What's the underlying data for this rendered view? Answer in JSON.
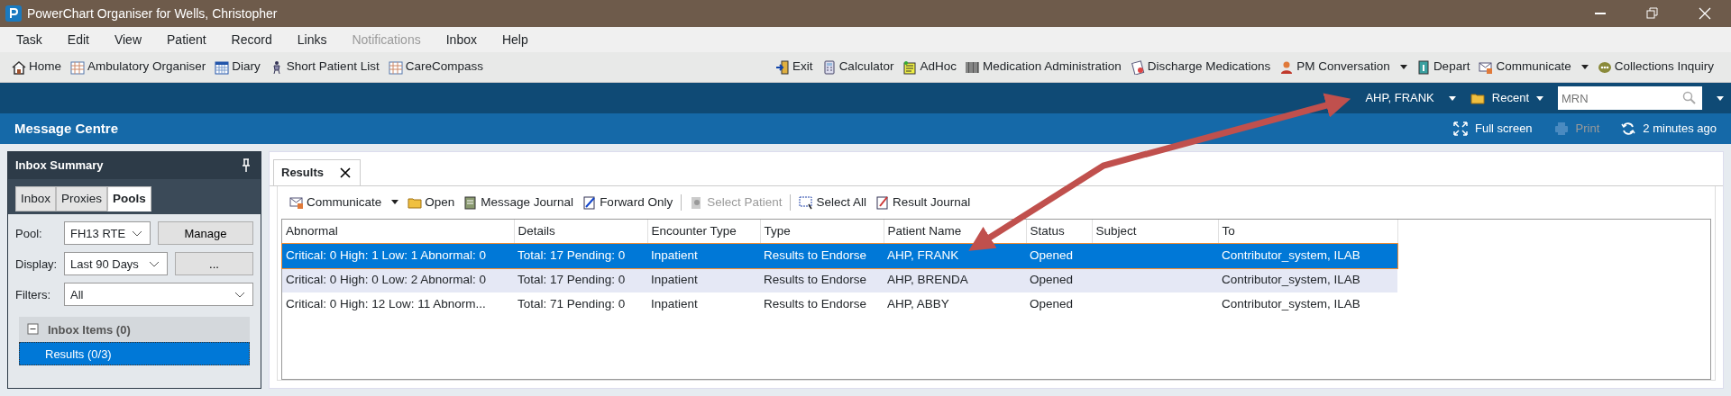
{
  "window": {
    "title": "PowerChart Organiser for Wells, Christopher"
  },
  "menu": [
    {
      "label": "Task",
      "disabled": false
    },
    {
      "label": "Edit",
      "disabled": false
    },
    {
      "label": "View",
      "disabled": false
    },
    {
      "label": "Patient",
      "disabled": false
    },
    {
      "label": "Record",
      "disabled": false
    },
    {
      "label": "Links",
      "disabled": false
    },
    {
      "label": "Notifications",
      "disabled": true
    },
    {
      "label": "Inbox",
      "disabled": false
    },
    {
      "label": "Help",
      "disabled": false
    }
  ],
  "toolbar_left": [
    {
      "label": "Home"
    },
    {
      "label": "Ambulatory Organiser"
    },
    {
      "label": "Diary"
    },
    {
      "label": "Short Patient List"
    },
    {
      "label": "CareCompass"
    }
  ],
  "toolbar_right": [
    {
      "label": "Exit",
      "dropdown": false
    },
    {
      "label": "Calculator",
      "dropdown": false
    },
    {
      "label": "AdHoc",
      "dropdown": false
    },
    {
      "label": "Medication Administration",
      "dropdown": false
    },
    {
      "label": "Discharge Medications",
      "dropdown": false
    },
    {
      "label": "PM Conversation",
      "dropdown": true
    },
    {
      "label": "Depart",
      "dropdown": false
    },
    {
      "label": "Communicate",
      "dropdown": true
    },
    {
      "label": "Collections Inquiry",
      "dropdown": false
    }
  ],
  "patient_bar": {
    "patient": "AHP, FRANK",
    "recent": "Recent",
    "search_placeholder": "MRN"
  },
  "header": {
    "title": "Message Centre",
    "actions": [
      {
        "label": "Full screen",
        "disabled": false
      },
      {
        "label": "Print",
        "disabled": true
      },
      {
        "label": "2 minutes ago",
        "disabled": false
      }
    ]
  },
  "inbox_summary": {
    "title": "Inbox Summary",
    "tabs": [
      {
        "label": "Inbox",
        "selected": false
      },
      {
        "label": "Proxies",
        "selected": false
      },
      {
        "label": "Pools",
        "selected": true
      }
    ],
    "pool": {
      "label": "Pool:",
      "value": "FH13 RTE",
      "button": "Manage"
    },
    "display": {
      "label": "Display:",
      "value": "Last 90 Days",
      "button": "..."
    },
    "filters": {
      "label": "Filters:",
      "value": "All"
    },
    "group": {
      "label": "Inbox Items (0)",
      "expanded": true,
      "items": [
        {
          "label": "Results (0/3)",
          "selected": true
        }
      ]
    }
  },
  "results": {
    "tab": "Results",
    "toolbar": [
      {
        "label": "Communicate",
        "dropdown": true,
        "disabled": false
      },
      {
        "label": "Open",
        "dropdown": false,
        "disabled": false
      },
      {
        "label": "Message Journal",
        "dropdown": false,
        "disabled": false
      },
      {
        "label": "Forward Only",
        "dropdown": false,
        "disabled": false
      },
      {
        "label": "Select Patient",
        "dropdown": false,
        "disabled": true
      },
      {
        "label": "Select All",
        "dropdown": false,
        "disabled": false
      },
      {
        "label": "Result Journal",
        "dropdown": false,
        "disabled": false
      }
    ],
    "table": {
      "columns": [
        "Abnormal",
        "Details",
        "Encounter Type",
        "Type",
        "Patient Name",
        "Status",
        "Subject",
        "To"
      ],
      "rows": [
        {
          "selected": true,
          "highlighted": false,
          "cells": [
            "Critical: 0 High: 1 Low: 1 Abnormal: 0",
            "Total: 17 Pending: 0",
            "Inpatient",
            "Results to Endorse",
            "AHP, FRANK",
            "Opened",
            "",
            "Contributor_system, ILAB"
          ]
        },
        {
          "selected": false,
          "highlighted": true,
          "cells": [
            "Critical: 0 High: 0 Low: 2 Abnormal: 0",
            "Total: 17 Pending: 0",
            "Inpatient",
            "Results to Endorse",
            "AHP, BRENDA",
            "Opened",
            "",
            "Contributor_system, ILAB"
          ]
        },
        {
          "selected": false,
          "highlighted": false,
          "cells": [
            "Critical: 0 High: 12 Low: 11 Abnorm...",
            "Total: 71 Pending: 0",
            "Inpatient",
            "Results to Endorse",
            "AHP, ABBY",
            "Opened",
            "",
            "Contributor_system, ILAB"
          ]
        }
      ]
    }
  }
}
